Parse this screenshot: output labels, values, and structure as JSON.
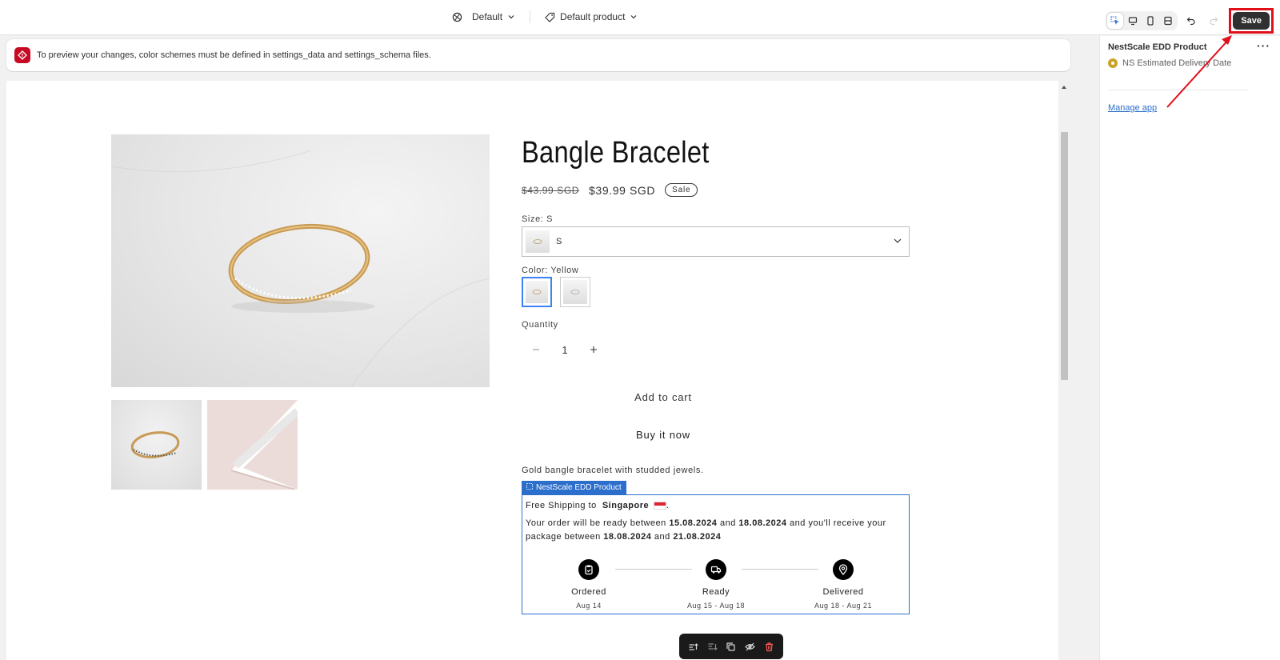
{
  "topbar": {
    "theme_label": "Default",
    "template_label": "Default product",
    "save_label": "Save"
  },
  "notice": {
    "text": "To preview your changes, color schemes must be defined in settings_data and settings_schema files."
  },
  "product": {
    "title": "Bangle Bracelet",
    "price_old": "$43.99 SGD",
    "price_new": "$39.99 SGD",
    "sale_badge": "Sale",
    "size_label": "Size: S",
    "size_value": "S",
    "color_label": "Color: Yellow",
    "quantity_label": "Quantity",
    "quantity_value": "1",
    "add_to_cart": "Add to cart",
    "buy_now": "Buy it now",
    "description": "Gold bangle bracelet with studded jewels."
  },
  "edd": {
    "tag": "NestScale EDD Product",
    "shipping_prefix": "Free Shipping to",
    "country": "Singapore",
    "line2_a": "Your order will be ready between",
    "ready_start": "15.08.2024",
    "and1": "and",
    "ready_end": "18.08.2024",
    "line2_b": "and you'll receive your package between",
    "deliver_start": "18.08.2024",
    "and2": "and",
    "deliver_end": "21.08.2024",
    "steps": [
      {
        "name": "Ordered",
        "date": "Aug 14",
        "icon": "clipboard-icon"
      },
      {
        "name": "Ready",
        "date": "Aug 15 - Aug 18",
        "icon": "truck-icon"
      },
      {
        "name": "Delivered",
        "date": "Aug 18 - Aug 21",
        "icon": "location-pin-icon"
      }
    ]
  },
  "sidebar": {
    "title": "NestScale EDD Product",
    "item": "NS Estimated Delivery Date",
    "manage_link": "Manage app"
  },
  "colors": {
    "save_highlight": "#e0101a",
    "app_blue": "#2c6ecb",
    "notice_red": "#c70a24"
  }
}
